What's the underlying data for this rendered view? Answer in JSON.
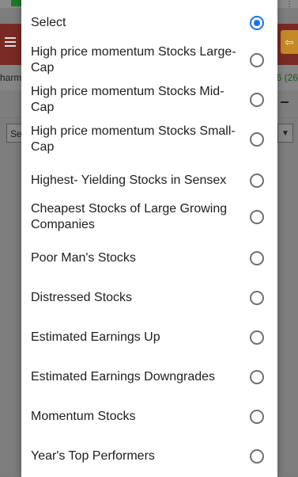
{
  "background": {
    "row_left_text": "harm",
    "row_right_text": "6 (26",
    "select_box_text": "Se",
    "dropdown_glyph": "▼",
    "orange_icon": "⇦",
    "overflow_icon": "⋮"
  },
  "dialog": {
    "selected_index": 0,
    "accent_color": "#1a73e8",
    "options": [
      {
        "label": "Select",
        "checked": true
      },
      {
        "label": "High price momentum Stocks Large-Cap",
        "checked": false
      },
      {
        "label": "High price momentum Stocks Mid-Cap",
        "checked": false
      },
      {
        "label": "High price momentum Stocks Small-Cap",
        "checked": false
      },
      {
        "label": "Highest- Yielding Stocks in Sensex",
        "checked": false
      },
      {
        "label": "Cheapest Stocks of Large Growing Companies",
        "checked": false
      },
      {
        "label": "Poor Man's Stocks",
        "checked": false
      },
      {
        "label": "Distressed Stocks",
        "checked": false
      },
      {
        "label": "Estimated Earnings Up",
        "checked": false
      },
      {
        "label": "Estimated Earnings Downgrades",
        "checked": false
      },
      {
        "label": "Momentum Stocks",
        "checked": false
      },
      {
        "label": "Year's Top Performers",
        "checked": false
      }
    ]
  }
}
